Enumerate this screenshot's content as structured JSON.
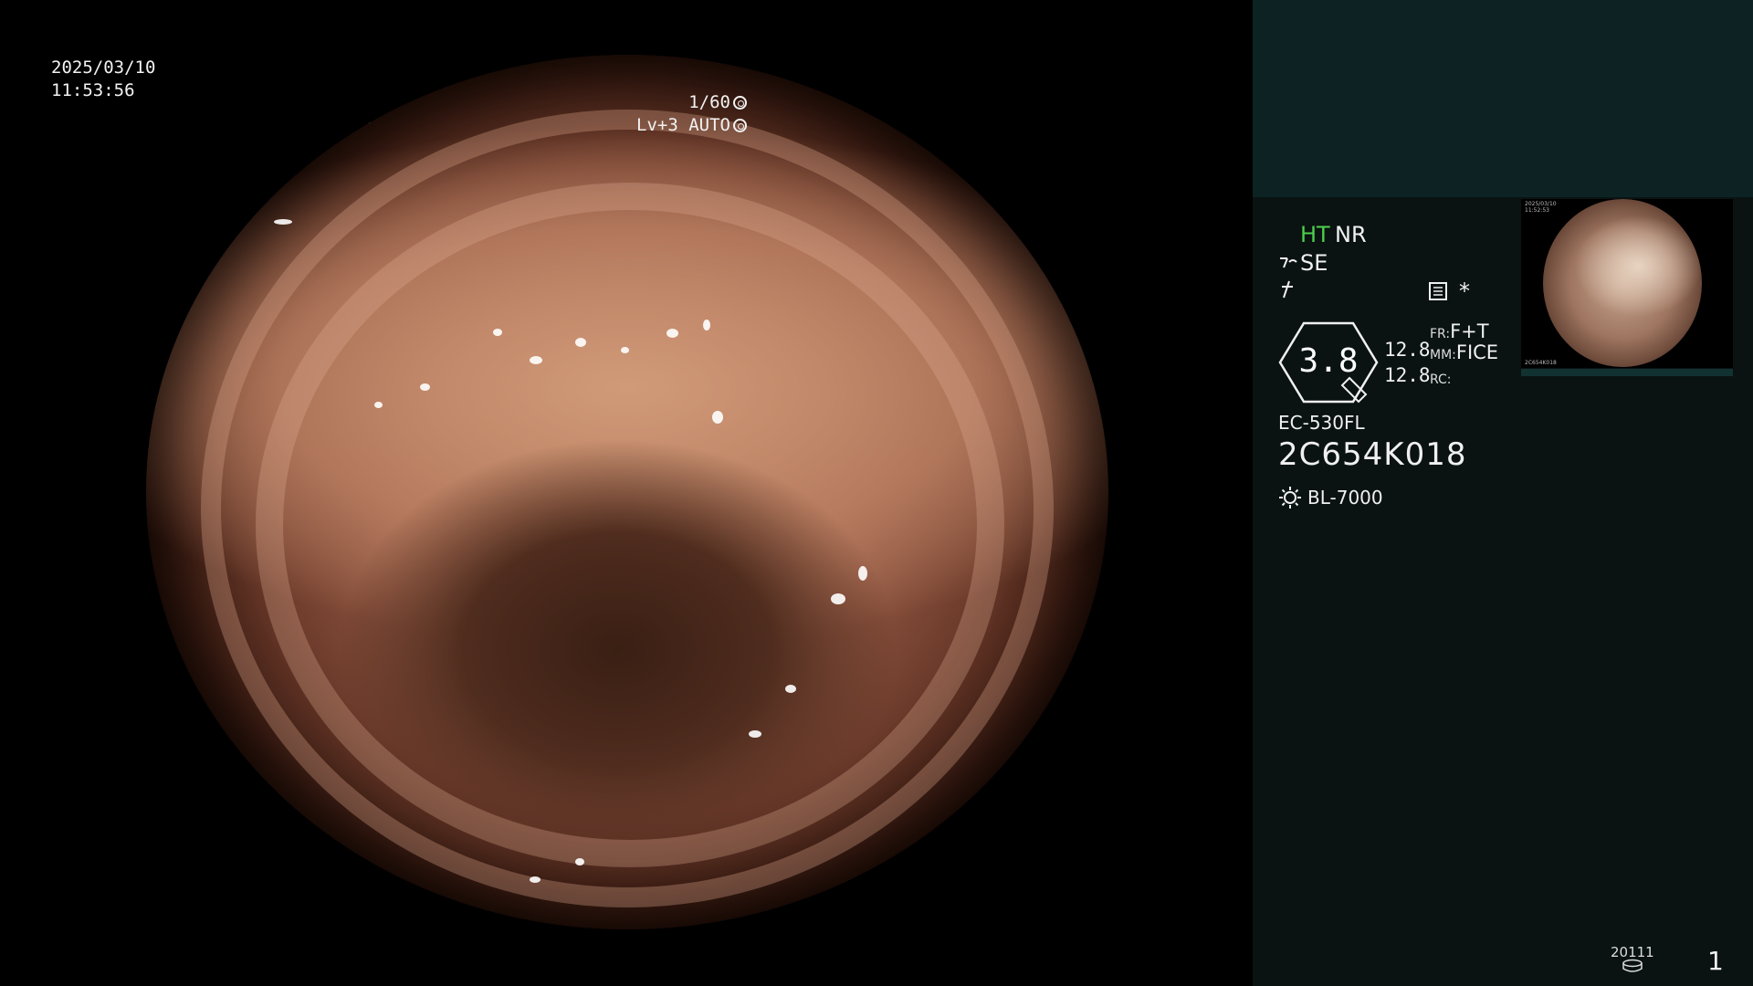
{
  "viewport": {
    "date": "2025/03/10",
    "time": "11:53:56",
    "shutter": "1/60",
    "iris": "Lv+3 AUTO"
  },
  "panel": {
    "ht": "HT",
    "nr": "NR",
    "se": "SE",
    "star": "*",
    "zoom": "3.8",
    "zoom_a": "12.8",
    "zoom_b": "12.8",
    "fr_key": "FR:",
    "fr_val": "F+T",
    "mm_key": "MM:",
    "mm_val": "FICE",
    "rc_key": "RC:",
    "rc_val": "",
    "scope_model": "EC-530FL",
    "scope_serial": "2C654K018",
    "light_source": "BL-7000",
    "counter_small": "20111",
    "counter_big": "1"
  },
  "thumbnail": {
    "date": "2025/03/10",
    "time": "11:52:53",
    "serial": "2C654K018"
  },
  "colors": {
    "panel_bg": "#0a1212",
    "top_band": "#0d2323",
    "ht_green": "#4cd04c"
  },
  "icons": [
    "shutter-icon",
    "iris-icon",
    "se-icon",
    "freeze-icon",
    "menu-icon",
    "zoom-badge-icon",
    "light-source-icon",
    "disk-icon"
  ]
}
